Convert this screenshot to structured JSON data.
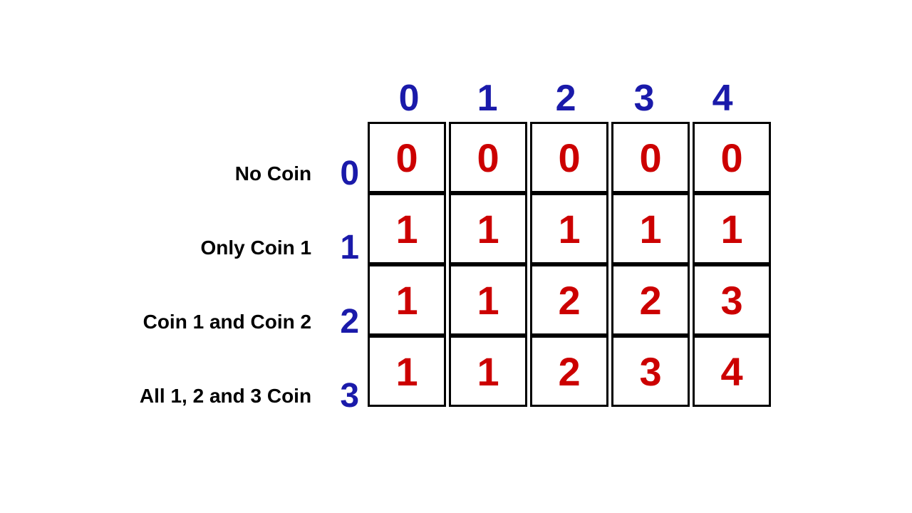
{
  "colHeaders": [
    "0",
    "1",
    "2",
    "3",
    "4"
  ],
  "rows": [
    {
      "label": "No Coin",
      "rowNum": "0",
      "cells": [
        "0",
        "0",
        "0",
        "0",
        "0"
      ]
    },
    {
      "label": "Only Coin 1",
      "rowNum": "1",
      "cells": [
        "1",
        "1",
        "1",
        "1",
        "1"
      ]
    },
    {
      "label": "Coin 1 and Coin 2",
      "rowNum": "2",
      "cells": [
        "1",
        "1",
        "2",
        "2",
        "3"
      ]
    },
    {
      "label": "All 1, 2 and 3 Coin",
      "rowNum": "3",
      "cells": [
        "1",
        "1",
        "2",
        "3",
        "4"
      ]
    }
  ]
}
